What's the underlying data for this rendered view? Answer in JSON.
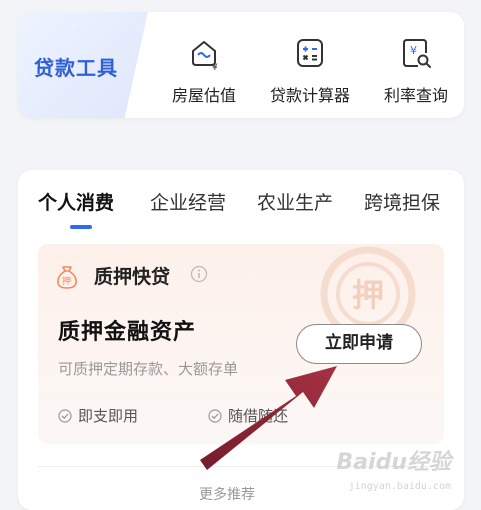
{
  "tools": {
    "banner_title": "贷款工具",
    "items": [
      {
        "label": "房屋估值",
        "icon": "house-valuation-icon"
      },
      {
        "label": "贷款计算器",
        "icon": "calculator-icon"
      },
      {
        "label": "利率查询",
        "icon": "rate-search-icon"
      }
    ]
  },
  "tabs": [
    "个人消费",
    "企业经营",
    "农业生产",
    "跨境担保"
  ],
  "active_tab": "个人消费",
  "promo": {
    "title": "质押快贷",
    "headline": "质押金融资产",
    "subtitle": "可质押定期存款、大额存单",
    "apply_label": "立即申请",
    "features": [
      "即支即用",
      "随借随还"
    ]
  },
  "more_link": "更多推荐",
  "watermark": {
    "logo": "Baidu经验",
    "url": "jingyan.baidu.com"
  },
  "colors": {
    "accent": "#2d6cf0",
    "promo_orange": "#f08a5d",
    "arrow": "#8b1a2b"
  }
}
